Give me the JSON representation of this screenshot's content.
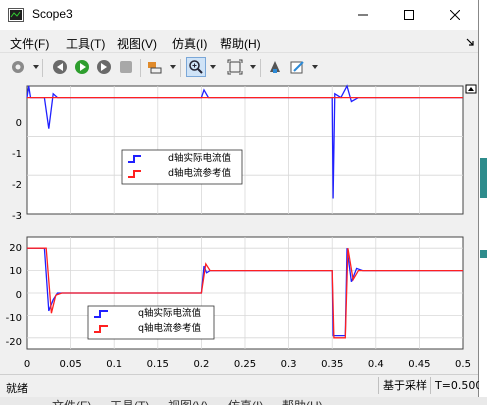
{
  "window": {
    "title": "Scope3"
  },
  "menu": [
    {
      "label": "文件(F)"
    },
    {
      "label": "工具(T)"
    },
    {
      "label": "视图(V)"
    },
    {
      "label": "仿真(I)"
    },
    {
      "label": "帮助(H)"
    }
  ],
  "toolbar_icons": [
    "settings-icon",
    "step-back-icon",
    "run-icon",
    "step-forward-icon",
    "stop-icon",
    "signal-trigger-icon",
    "zoom-icon",
    "fit-to-view-icon",
    "highlight-icon",
    "edit-icon"
  ],
  "plots": {
    "top": {
      "yticks": [
        "0",
        "-1",
        "-2",
        "-3"
      ],
      "legend": [
        "d轴实际电流值",
        "d轴电流参考值"
      ]
    },
    "bottom": {
      "yticks": [
        "20",
        "10",
        "0",
        "-10",
        "-20"
      ],
      "legend": [
        "q轴实际电流值",
        "q轴电流参考值"
      ]
    },
    "xticks": [
      "0",
      "0.05",
      "0.1",
      "0.15",
      "0.2",
      "0.25",
      "0.3",
      "0.35",
      "0.4",
      "0.45",
      "0.5"
    ]
  },
  "chart_data": [
    {
      "type": "line",
      "xlim": [
        0,
        0.5
      ],
      "ylim": [
        -3,
        0.3
      ],
      "grid": true,
      "legend_position": "center-left",
      "series": [
        {
          "name": "d轴实际电流值",
          "color": "#2020ff",
          "points": [
            [
              0,
              0
            ],
            [
              0.002,
              0.3
            ],
            [
              0.004,
              0
            ],
            [
              0.02,
              0
            ],
            [
              0.025,
              -0.8
            ],
            [
              0.03,
              0.1
            ],
            [
              0.035,
              0
            ],
            [
              0.2,
              0
            ],
            [
              0.203,
              0.2
            ],
            [
              0.208,
              0
            ],
            [
              0.35,
              0
            ],
            [
              0.351,
              -2.6
            ],
            [
              0.353,
              0.1
            ],
            [
              0.36,
              0
            ],
            [
              0.367,
              0.3
            ],
            [
              0.372,
              -0.1
            ],
            [
              0.38,
              0
            ],
            [
              0.5,
              0
            ]
          ]
        },
        {
          "name": "d轴电流参考值",
          "color": "#ff2020",
          "points": [
            [
              0,
              0
            ],
            [
              0.5,
              0
            ]
          ]
        }
      ]
    },
    {
      "type": "line",
      "xlim": [
        0,
        0.5
      ],
      "ylim": [
        -25,
        25
      ],
      "grid": true,
      "legend_position": "bottom-left",
      "series": [
        {
          "name": "q轴实际电流值",
          "color": "#2020ff",
          "points": [
            [
              0,
              20
            ],
            [
              0.02,
              20
            ],
            [
              0.025,
              -8
            ],
            [
              0.03,
              -3
            ],
            [
              0.035,
              0
            ],
            [
              0.2,
              0
            ],
            [
              0.203,
              12
            ],
            [
              0.206,
              9
            ],
            [
              0.21,
              10
            ],
            [
              0.35,
              10
            ],
            [
              0.351,
              -19
            ],
            [
              0.365,
              -19
            ],
            [
              0.367,
              20
            ],
            [
              0.372,
              5
            ],
            [
              0.378,
              11
            ],
            [
              0.385,
              10
            ],
            [
              0.5,
              10
            ]
          ]
        },
        {
          "name": "q轴电流参考值",
          "color": "#ff2020",
          "points": [
            [
              0,
              20
            ],
            [
              0.022,
              20
            ],
            [
              0.028,
              -9
            ],
            [
              0.033,
              -1
            ],
            [
              0.04,
              0
            ],
            [
              0.2,
              0
            ],
            [
              0.205,
              13
            ],
            [
              0.21,
              10
            ],
            [
              0.35,
              10
            ],
            [
              0.352,
              -20
            ],
            [
              0.365,
              -20
            ],
            [
              0.368,
              20
            ],
            [
              0.374,
              6
            ],
            [
              0.38,
              10
            ],
            [
              0.5,
              10
            ]
          ]
        }
      ]
    }
  ],
  "status": {
    "left": "就绪",
    "sampling": "基于采样",
    "time": "T=0.500"
  },
  "background_menu": [
    {
      "label": "文件(F)"
    },
    {
      "label": "工具(T)"
    },
    {
      "label": "视图(V)"
    },
    {
      "label": "仿真(I)"
    },
    {
      "label": "帮助(H)"
    }
  ]
}
